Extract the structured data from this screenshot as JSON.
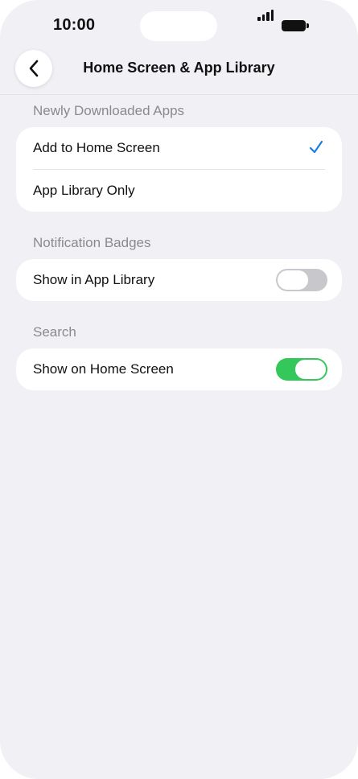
{
  "status_bar": {
    "time": "10:00"
  },
  "nav": {
    "title": "Home Screen & App Library"
  },
  "sections": {
    "newly_downloaded": {
      "header": "Newly Downloaded Apps",
      "options": [
        {
          "label": "Add to Home Screen",
          "selected": true
        },
        {
          "label": "App Library Only",
          "selected": false
        }
      ]
    },
    "notification_badges": {
      "header": "Notification Badges",
      "show_in_app_library": {
        "label": "Show in App Library",
        "on": false
      }
    },
    "search": {
      "header": "Search",
      "show_on_home_screen": {
        "label": "Show on Home Screen",
        "on": true
      }
    }
  },
  "colors": {
    "accent": "#1a7ee0",
    "toggle_on": "#34c759",
    "toggle_off": "#c7c7cc",
    "background": "#f0f0f5"
  }
}
